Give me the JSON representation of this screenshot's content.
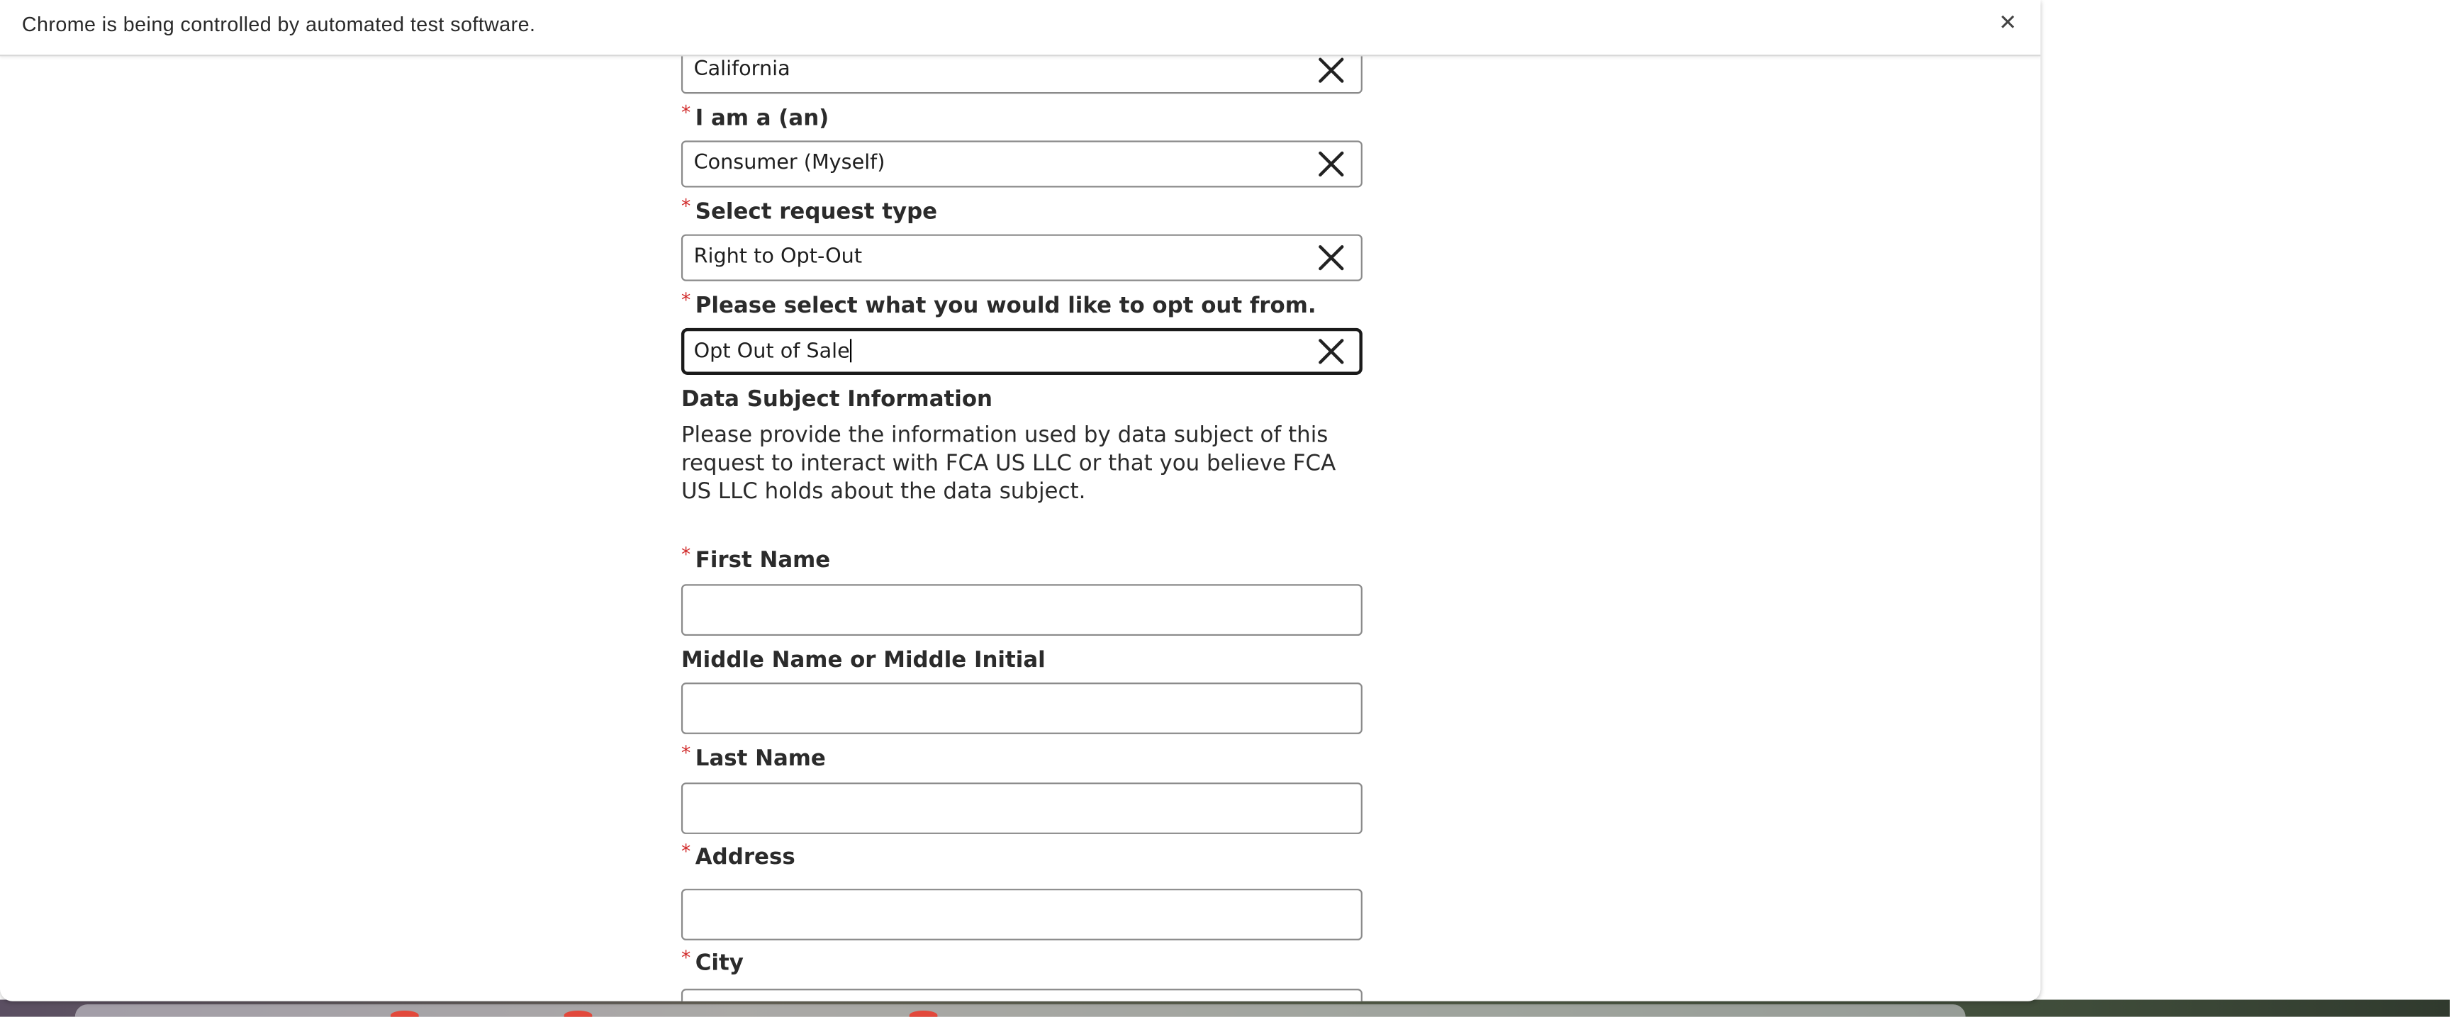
{
  "infobar": {
    "message": "Chrome is being controlled by automated test software.",
    "close_glyph": "✕"
  },
  "form": {
    "state_value": "California",
    "i_am_label": "I am a (an)",
    "i_am_value": "Consumer (Myself)",
    "request_type_label": "Select request type",
    "request_type_value": "Right to Opt-Out",
    "opt_out_label": "Please select what you would like to opt out from.",
    "opt_out_value": "Opt Out of Sale",
    "section_title": "Data Subject Information",
    "section_desc": "Please provide the information used by data subject of this request to interact with FCA US LLC or that you believe FCA US LLC holds about the data subject.",
    "first_name_label": "First Name",
    "middle_name_label": "Middle Name or Middle Initial",
    "last_name_label": "Last Name",
    "address_label": "Address",
    "city_label": "City",
    "required_marker": "*"
  },
  "colors": {
    "required": "#d12b2b",
    "text": "#2b2b2b",
    "border": "#8a8a8a"
  },
  "icons": {
    "clear": "close-icon",
    "infobar_close": "close-icon"
  }
}
